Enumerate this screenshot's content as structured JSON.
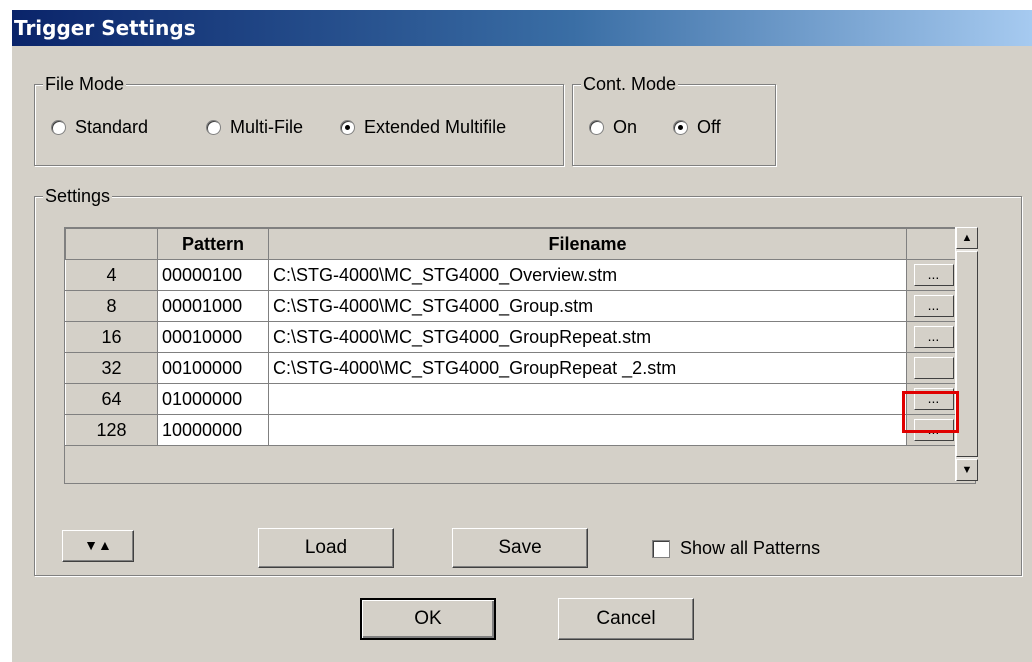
{
  "window": {
    "title": "Trigger Settings"
  },
  "file_mode": {
    "label": "File Mode",
    "options": [
      {
        "label": "Standard",
        "selected": false
      },
      {
        "label": "Multi-File",
        "selected": false
      },
      {
        "label": "Extended Multifile",
        "selected": true
      }
    ]
  },
  "cont_mode": {
    "label": "Cont. Mode",
    "options": [
      {
        "label": "On",
        "selected": false
      },
      {
        "label": "Off",
        "selected": true
      }
    ]
  },
  "settings": {
    "label": "Settings",
    "columns": [
      "",
      "Pattern",
      "Filename",
      ""
    ],
    "rows": [
      {
        "num": "4",
        "pattern": "00000100",
        "filename": "C:\\STG-4000\\MC_STG4000_Overview.stm",
        "browse": "..."
      },
      {
        "num": "8",
        "pattern": "00001000",
        "filename": "C:\\STG-4000\\MC_STG4000_Group.stm",
        "browse": "..."
      },
      {
        "num": "16",
        "pattern": "00010000",
        "filename": "C:\\STG-4000\\MC_STG4000_GroupRepeat.stm",
        "browse": "..."
      },
      {
        "num": "32",
        "pattern": "00100000",
        "filename": "C:\\STG-4000\\MC_STG4000_GroupRepeat _2.stm",
        "browse": ""
      },
      {
        "num": "64",
        "pattern": "01000000",
        "filename": "",
        "browse": "..."
      },
      {
        "num": "128",
        "pattern": "10000000",
        "filename": "",
        "browse": "..."
      }
    ],
    "sort_button": "▼▲",
    "load_button": "Load",
    "save_button": "Save",
    "show_all_patterns": {
      "label": "Show all Patterns",
      "checked": false
    }
  },
  "ok_button": "OK",
  "cancel_button": "Cancel",
  "icons": {
    "scroll_up": "triangle-up-icon",
    "scroll_down": "triangle-down-icon"
  },
  "colors": {
    "highlight": "#e00000",
    "titlebar": "#0a246a",
    "face": "#d4d0c8"
  }
}
